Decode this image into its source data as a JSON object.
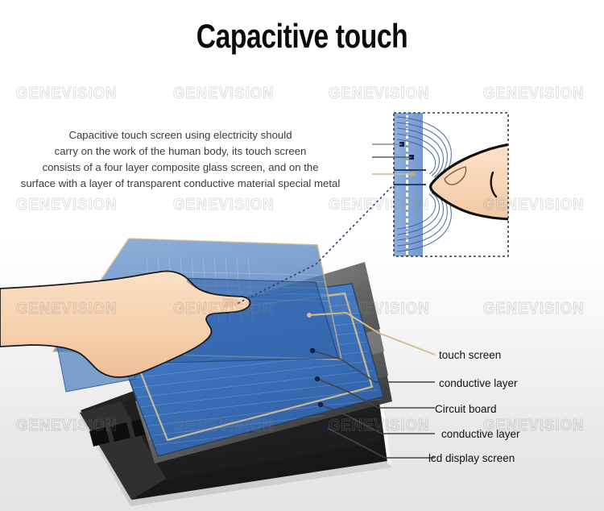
{
  "page": {
    "title": "Capacitive touch",
    "background_top": "#ffffff",
    "background_bottom": "#e4e4e4"
  },
  "watermark": {
    "text": "GENEVISION",
    "color": "#8c8c8c",
    "columns_x": [
      20,
      215,
      408,
      600
    ],
    "rows_y": [
      105,
      243,
      372,
      517
    ]
  },
  "description": {
    "line1": "Capacitive touch screen using electricity should",
    "line2": "carry on the work of the human body, its touch screen",
    "line3": "consists of a four layer composite glass screen, and on the",
    "line4": "surface with a layer of transparent conductive material special metal"
  },
  "callouts": {
    "items": [
      {
        "label": "touch screen",
        "leader_color": "#d4bd8e"
      },
      {
        "label": "conductive layer",
        "leader_color": "#4d4d4d"
      },
      {
        "label": "Circuit board",
        "leader_color": "#4d4d4d"
      },
      {
        "label": "conductive layer",
        "leader_color": "#4d4d4d"
      },
      {
        "label": "lcd display screen",
        "leader_color": "#4d4d4d"
      }
    ]
  },
  "inset": {
    "name": "capacitive-field-detail",
    "border_style": "dashed",
    "border_color": "#4a4a4a",
    "glass_color": "#7e9fd6",
    "field_line_color": "#4b6ea8",
    "skin_color": "#f3cdae"
  },
  "diagram": {
    "screen_glass_color": "#4f7fc0",
    "tablet_body_color": "#2b2b2b",
    "skin_color": "#f6d3b2",
    "connector_color": "#2d3f66"
  },
  "colors": {
    "accent_gold": "#d4bd8e",
    "text_dark": "#101010",
    "text_body": "#3b3b3b"
  }
}
